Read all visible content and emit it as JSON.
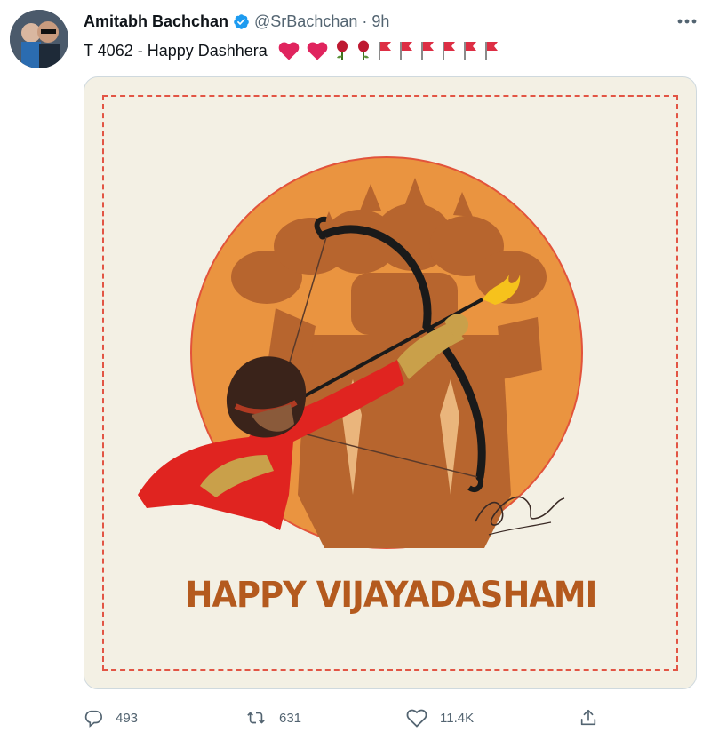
{
  "tweet": {
    "author_name": "Amitabh Bachchan",
    "author_handle": "@SrBachchan",
    "separator": "·",
    "timestamp": "9h",
    "verified": true,
    "text": "T 4062 - Happy Dashhera",
    "emojis": [
      "heart",
      "heart",
      "rose",
      "rose",
      "red-flag",
      "red-flag",
      "red-flag",
      "red-flag",
      "red-flag",
      "red-flag"
    ]
  },
  "media": {
    "caption": "HAPPY VIJAYADASHAMI"
  },
  "actions": {
    "replies": "493",
    "retweets": "631",
    "likes": "11.4K"
  },
  "colors": {
    "name": "#0f1419",
    "secondary": "#536471",
    "verified": "#1d9bf0",
    "heart": "#e0245e",
    "flag": "#dd2e44",
    "card_background": "#f3f0e4",
    "card_border": "#e25545",
    "circle": "#e8913a",
    "caption": "#b45a1e"
  }
}
